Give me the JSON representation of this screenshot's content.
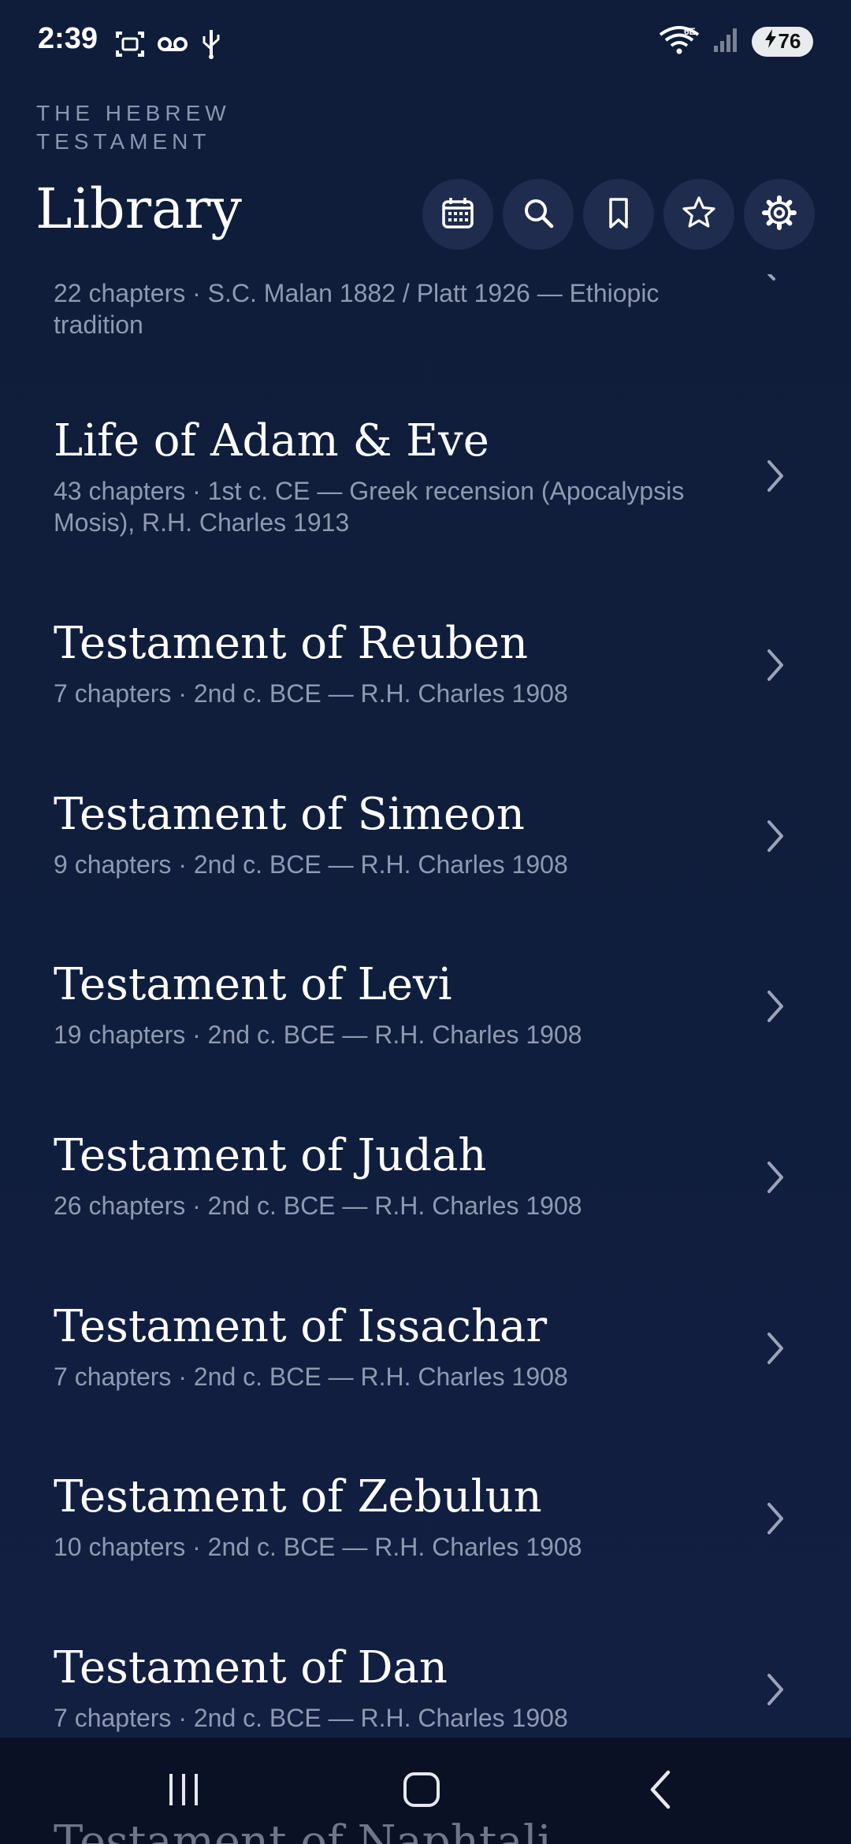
{
  "status_bar": {
    "time": "2:39",
    "battery": "76",
    "network": "6E"
  },
  "header": {
    "eyebrow": "THE HEBREW TESTAMENT",
    "title": "Library"
  },
  "toolbar": {
    "icons": [
      "calendar-icon",
      "search-icon",
      "bookmark-icon",
      "star-icon",
      "settings-icon"
    ]
  },
  "partial_item": {
    "subtitle": "22 chapters · S.C. Malan 1882 / Platt 1926 — Ethiopic tradition"
  },
  "items": [
    {
      "title": "Life of Adam & Eve",
      "subtitle": "43 chapters · 1st c. CE — Greek recension (Apocalypsis Mosis), R.H. Charles 1913"
    },
    {
      "title": "Testament of Reuben",
      "subtitle": "7 chapters · 2nd c. BCE — R.H. Charles 1908"
    },
    {
      "title": "Testament of Simeon",
      "subtitle": "9 chapters · 2nd c. BCE — R.H. Charles 1908"
    },
    {
      "title": "Testament of Levi",
      "subtitle": "19 chapters · 2nd c. BCE — R.H. Charles 1908"
    },
    {
      "title": "Testament of Judah",
      "subtitle": "26 chapters · 2nd c. BCE — R.H. Charles 1908"
    },
    {
      "title": "Testament of Issachar",
      "subtitle": "7 chapters · 2nd c. BCE — R.H. Charles 1908"
    },
    {
      "title": "Testament of Zebulun",
      "subtitle": "10 chapters · 2nd c. BCE — R.H. Charles 1908"
    },
    {
      "title": "Testament of Dan",
      "subtitle": "7 chapters · 2nd c. BCE — R.H. Charles 1908"
    }
  ],
  "peek_item": {
    "title": "Testament of Naphtali"
  },
  "nav_bar": {
    "icons": [
      "recent-apps-icon",
      "home-icon",
      "back-icon"
    ]
  }
}
